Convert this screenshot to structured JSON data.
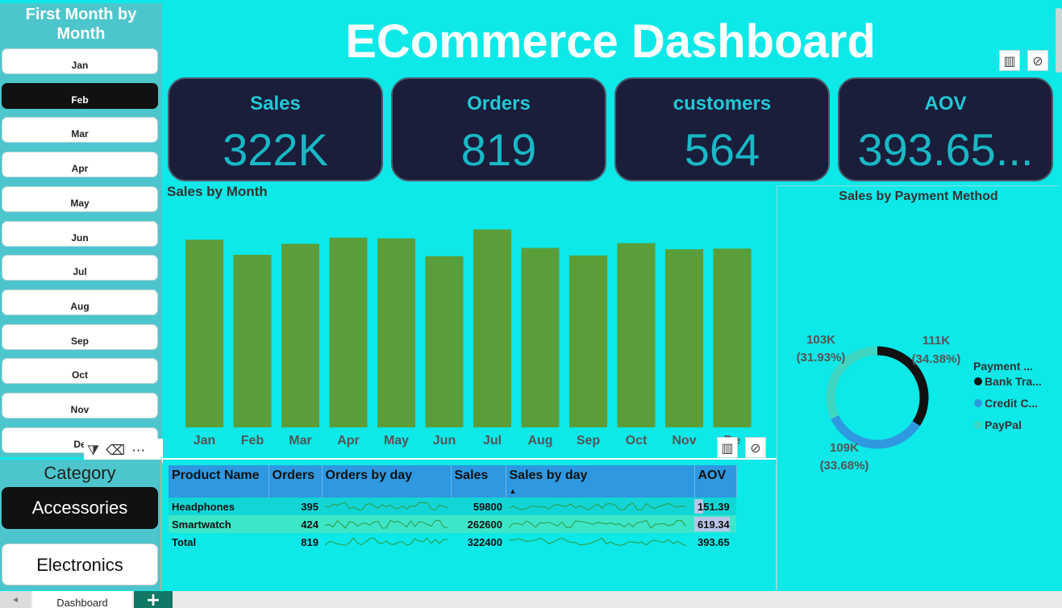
{
  "header": {
    "title": "ECommerce Dashboard"
  },
  "month_slicer": {
    "title": "First Month by Month",
    "items": [
      {
        "label": "Jan",
        "selected": false
      },
      {
        "label": "Feb",
        "selected": true
      },
      {
        "label": "Mar",
        "selected": false
      },
      {
        "label": "Apr",
        "selected": false
      },
      {
        "label": "May",
        "selected": false
      },
      {
        "label": "Jun",
        "selected": false
      },
      {
        "label": "Jul",
        "selected": false
      },
      {
        "label": "Aug",
        "selected": false
      },
      {
        "label": "Sep",
        "selected": false
      },
      {
        "label": "Oct",
        "selected": false
      },
      {
        "label": "Nov",
        "selected": false
      },
      {
        "label": "De",
        "selected": false
      }
    ],
    "toolbar_icons": [
      "filter-icon",
      "eraser-icon",
      "more-options-icon"
    ]
  },
  "category_slicer": {
    "title": "Category",
    "items": [
      {
        "label": "Accessories",
        "selected": true
      },
      {
        "label": "Electronics",
        "selected": false
      }
    ]
  },
  "kpis": [
    {
      "label": "Sales",
      "value": "322K"
    },
    {
      "label": "Orders",
      "value": "819"
    },
    {
      "label": "customers",
      "value": "564"
    },
    {
      "label": "AOV",
      "value": "393.65..."
    }
  ],
  "colors": {
    "background": "#0de8e8",
    "bar": "#5a9e3a",
    "kpi_card": "#1a1e3a",
    "kpi_text": "#19b8c6",
    "bank_transfer": "#111111",
    "credit_card": "#2e98e0",
    "paypal": "#3ed6c0"
  },
  "chart_data": [
    {
      "type": "bar",
      "title": "Sales by Month",
      "categories": [
        "Jan",
        "Feb",
        "Mar",
        "Apr",
        "May",
        "Jun",
        "Jul",
        "Aug",
        "Sep",
        "Oct",
        "Nov",
        "Dec"
      ],
      "category_labels_shown": [
        "Jan",
        "Feb",
        "Mar",
        "Apr",
        "May",
        "Jun",
        "Jul",
        "Aug",
        "Sep",
        "Oct",
        "Nov",
        "De"
      ],
      "values": [
        27.4,
        25.2,
        26.8,
        27.7,
        27.6,
        25.0,
        28.9,
        26.2,
        25.1,
        26.9,
        26.0,
        26.1
      ],
      "ylim": [
        0,
        30
      ],
      "grid": false,
      "legend": false
    },
    {
      "type": "pie",
      "title": "Sales by Payment Method",
      "legend_title": "Payment ...",
      "legend_position": "right",
      "slices": [
        {
          "name": "Bank Tra...",
          "value": 111,
          "label": "111K",
          "percent_label": "(34.38%)",
          "color": "#111111"
        },
        {
          "name": "Credit C...",
          "value": 109,
          "label": "109K",
          "percent_label": "(33.68%)",
          "color": "#2e98e0"
        },
        {
          "name": "PayPal",
          "value": 103,
          "label": "103K",
          "percent_label": "(31.93%)",
          "color": "#3ed6c0"
        }
      ]
    }
  ],
  "table": {
    "columns": [
      "Product Name",
      "Orders",
      "Orders by day",
      "Sales",
      "Sales by day",
      "AOV"
    ],
    "rows": [
      {
        "product": "Headphones",
        "orders": "395",
        "sales": "59800",
        "aov": "151.39",
        "aov_fill": 0.24
      },
      {
        "product": "Smartwatch",
        "orders": "424",
        "sales": "262600",
        "aov": "619.34",
        "aov_fill": 1.0
      },
      {
        "product": "Total",
        "orders": "819",
        "sales": "322400",
        "aov": "393.65",
        "aov_fill": 0
      }
    ]
  },
  "tabs": {
    "current": "Dashboard",
    "add": "+"
  }
}
